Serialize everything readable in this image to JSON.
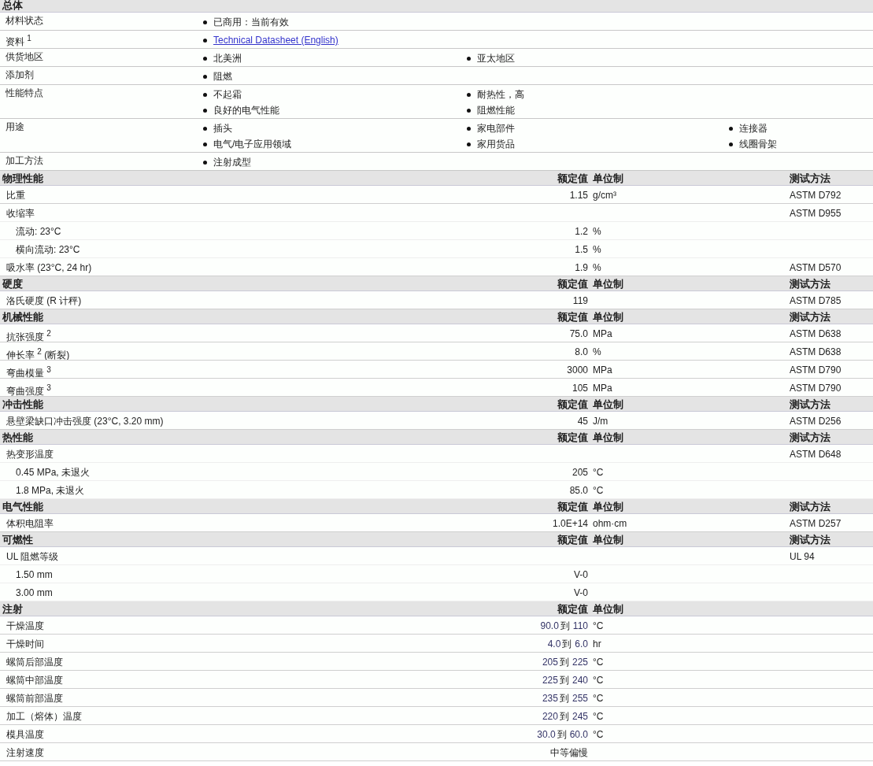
{
  "general": {
    "title": "总体",
    "rows": [
      {
        "label": "材料状态",
        "columns": [
          [
            {
              "text": "已商用：当前有效",
              "kind": "text"
            }
          ]
        ]
      },
      {
        "label": "资料 $^{1}$",
        "columns": [
          [
            {
              "text": "Technical Datasheet (English)",
              "kind": "link"
            }
          ]
        ]
      },
      {
        "label": "供货地区",
        "columns": [
          [
            {
              "text": "北美洲",
              "kind": "text"
            }
          ],
          [
            {
              "text": "亚太地区",
              "kind": "text"
            }
          ]
        ]
      },
      {
        "label": "添加剂",
        "columns": [
          [
            {
              "text": "阻燃",
              "kind": "text"
            }
          ]
        ]
      },
      {
        "label": "性能特点",
        "columns": [
          [
            {
              "text": "不起霜",
              "kind": "text"
            },
            {
              "text": "良好的电气性能",
              "kind": "text"
            }
          ],
          [
            {
              "text": "耐热性，高",
              "kind": "text"
            },
            {
              "text": "阻燃性能",
              "kind": "text"
            }
          ]
        ]
      },
      {
        "label": "用途",
        "columns": [
          [
            {
              "text": "插头",
              "kind": "text"
            },
            {
              "text": "电气/电子应用领域",
              "kind": "text"
            }
          ],
          [
            {
              "text": "家电部件",
              "kind": "text"
            },
            {
              "text": "家用货品",
              "kind": "text"
            }
          ],
          [
            {
              "text": "连接器",
              "kind": "text"
            },
            {
              "text": "线圈骨架",
              "kind": "text"
            }
          ]
        ]
      },
      {
        "label": "加工方法",
        "columns": [
          [
            {
              "text": "注射成型",
              "kind": "text"
            }
          ]
        ]
      }
    ]
  },
  "sections": [
    {
      "title": "物理性能",
      "value_header": "额定值",
      "unit_header": "单位制",
      "method_header": "测试方法",
      "rows": [
        {
          "label": "比重",
          "value": "1.15",
          "unit": "g/cm³",
          "method": "ASTM D792"
        },
        {
          "label": "收缩率",
          "method": "ASTM D955",
          "children": [
            {
              "label": "流动: 23°C",
              "value": "1.2",
              "unit": "%"
            },
            {
              "label": "横向流动: 23°C",
              "value": "1.5",
              "unit": "%"
            }
          ]
        },
        {
          "label": "吸水率  (23°C, 24 hr)",
          "value": "1.9",
          "unit": "%",
          "method": "ASTM D570"
        }
      ]
    },
    {
      "title": "硬度",
      "value_header": "额定值",
      "unit_header": "单位制",
      "method_header": "测试方法",
      "rows": [
        {
          "label": "洛氏硬度  (R 计秤)",
          "value": "119",
          "method": "ASTM D785"
        }
      ]
    },
    {
      "title": "机械性能",
      "value_header": "额定值",
      "unit_header": "单位制",
      "method_header": "测试方法",
      "rows": [
        {
          "label": "抗张强度 $^{2}$",
          "value": "75.0",
          "unit": "MPa",
          "method": "ASTM D638"
        },
        {
          "label": "伸长率 $^{2}$ (断裂)",
          "value": "8.0",
          "unit": "%",
          "method": "ASTM D638"
        },
        {
          "label": "弯曲模量 $^{3}$",
          "value": "3000",
          "unit": "MPa",
          "method": "ASTM D790"
        },
        {
          "label": "弯曲强度 $^{3}$",
          "value": "105",
          "unit": "MPa",
          "method": "ASTM D790"
        }
      ]
    },
    {
      "title": "冲击性能",
      "value_header": "额定值",
      "unit_header": "单位制",
      "method_header": "测试方法",
      "rows": [
        {
          "label": "悬壁梁缺口冲击强度  (23°C, 3.20 mm)",
          "value": "45",
          "unit": "J/m",
          "method": "ASTM D256"
        }
      ]
    },
    {
      "title": "热性能",
      "value_header": "额定值",
      "unit_header": "单位制",
      "method_header": "测试方法",
      "rows": [
        {
          "label": "热变形温度",
          "method": "ASTM D648",
          "children": [
            {
              "label": "0.45 MPa, 未退火",
              "value": "205",
              "unit": "°C"
            },
            {
              "label": "1.8 MPa, 未退火",
              "value": "85.0",
              "unit": "°C"
            }
          ]
        }
      ]
    },
    {
      "title": "电气性能",
      "value_header": "额定值",
      "unit_header": "单位制",
      "method_header": "测试方法",
      "rows": [
        {
          "label": "体积电阻率",
          "value": "1.0E+14",
          "unit": "ohm·cm",
          "method": "ASTM D257"
        }
      ]
    },
    {
      "title": "可燃性",
      "value_header": "额定值",
      "unit_header": "单位制",
      "method_header": "测试方法",
      "rows": [
        {
          "label": "UL 阻燃等级",
          "method": "UL 94",
          "children": [
            {
              "label": "1.50 mm",
              "value": "V-0"
            },
            {
              "label": "3.00 mm",
              "value": "V-0"
            }
          ]
        }
      ]
    },
    {
      "title": "注射",
      "value_header": "额定值",
      "unit_header": "单位制",
      "rows": [
        {
          "label": "干燥温度",
          "value": "90.0",
          "range_word": "到",
          "value_to": "110",
          "unit": "°C"
        },
        {
          "label": "干燥时间",
          "value": "4.0",
          "range_word": "到",
          "value_to": "6.0",
          "unit": "hr"
        },
        {
          "label": "螺筒后部温度",
          "value": "205",
          "range_word": "到",
          "value_to": "225",
          "unit": "°C"
        },
        {
          "label": "螺筒中部温度",
          "value": "225",
          "range_word": "到",
          "value_to": "240",
          "unit": "°C"
        },
        {
          "label": "螺筒前部温度",
          "value": "235",
          "range_word": "到",
          "value_to": "255",
          "unit": "°C"
        },
        {
          "label": "加工（熔体）温度",
          "value": "220",
          "range_word": "到",
          "value_to": "245",
          "unit": "°C"
        },
        {
          "label": "模具温度",
          "value": "30.0",
          "range_word": "到",
          "value_to": "60.0",
          "unit": "°C"
        },
        {
          "label": "注射速度",
          "value": "中等偏慢"
        }
      ]
    }
  ]
}
